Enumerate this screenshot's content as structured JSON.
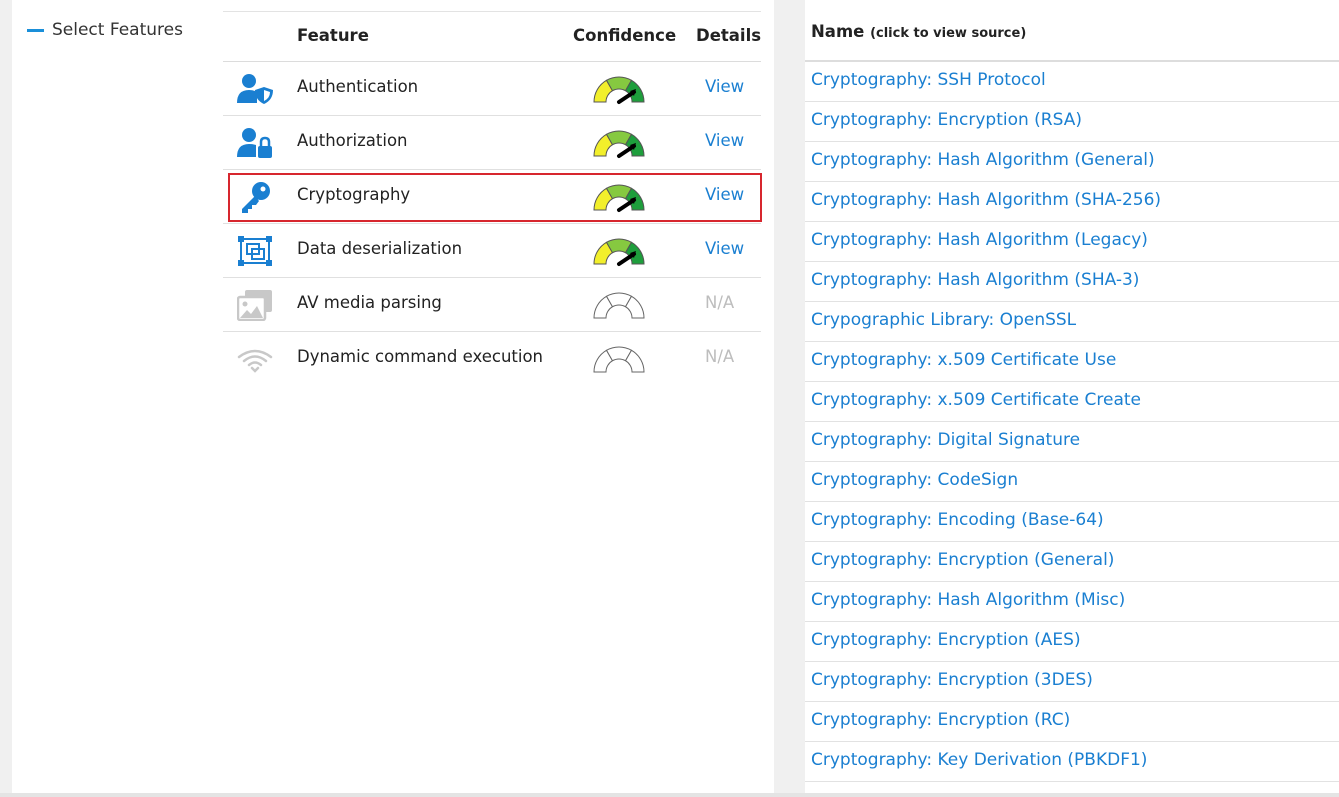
{
  "sidebar": {
    "toggle_label": "Select Features"
  },
  "features_table": {
    "headers": {
      "feature": "Feature",
      "confidence": "Confidence",
      "details": "Details"
    },
    "rows": [
      {
        "name": "Authentication",
        "icon": "user-shield-icon",
        "confidence": "high",
        "details": "View",
        "details_enabled": true
      },
      {
        "name": "Authorization",
        "icon": "user-lock-icon",
        "confidence": "high",
        "details": "View",
        "details_enabled": true
      },
      {
        "name": "Cryptography",
        "icon": "key-icon",
        "confidence": "high",
        "details": "View",
        "details_enabled": true,
        "highlighted": true
      },
      {
        "name": "Data deserialization",
        "icon": "object-group-icon",
        "confidence": "high",
        "details": "View",
        "details_enabled": true
      },
      {
        "name": "AV media parsing",
        "icon": "photo-film-icon",
        "confidence": "none",
        "details": "N/A",
        "details_enabled": false
      },
      {
        "name": "Dynamic command execution",
        "icon": "wifi-icon",
        "confidence": "none",
        "details": "N/A",
        "details_enabled": false
      }
    ]
  },
  "sources_table": {
    "header": {
      "name": "Name",
      "hint": "(click to view source)"
    },
    "rows": [
      "Cryptography: SSH Protocol",
      "Cryptography: Encryption (RSA)",
      "Cryptography: Hash Algorithm (General)",
      "Cryptography: Hash Algorithm (SHA-256)",
      "Cryptography: Hash Algorithm (Legacy)",
      "Cryptography: Hash Algorithm (SHA-3)",
      "Crypographic Library: OpenSSL",
      "Cryptography: x.509 Certificate Use",
      "Cryptography: x.509 Certificate Create",
      "Cryptography: Digital Signature",
      "Cryptography: CodeSign",
      "Cryptography: Encoding (Base-64)",
      "Cryptography: Encryption (General)",
      "Cryptography: Hash Algorithm (Misc)",
      "Cryptography: Encryption (AES)",
      "Cryptography: Encryption (3DES)",
      "Cryptography: Encryption (RC)",
      "Cryptography: Key Derivation (PBKDF1)"
    ]
  },
  "colors": {
    "link": "#1a7fd1",
    "icon_active": "#1a7fd1",
    "icon_disabled": "#c8c8c8",
    "highlight": "#d7262e",
    "gauge_yellow": "#f2ef2b",
    "gauge_light_green": "#86c940",
    "gauge_green": "#1e9e3c"
  }
}
